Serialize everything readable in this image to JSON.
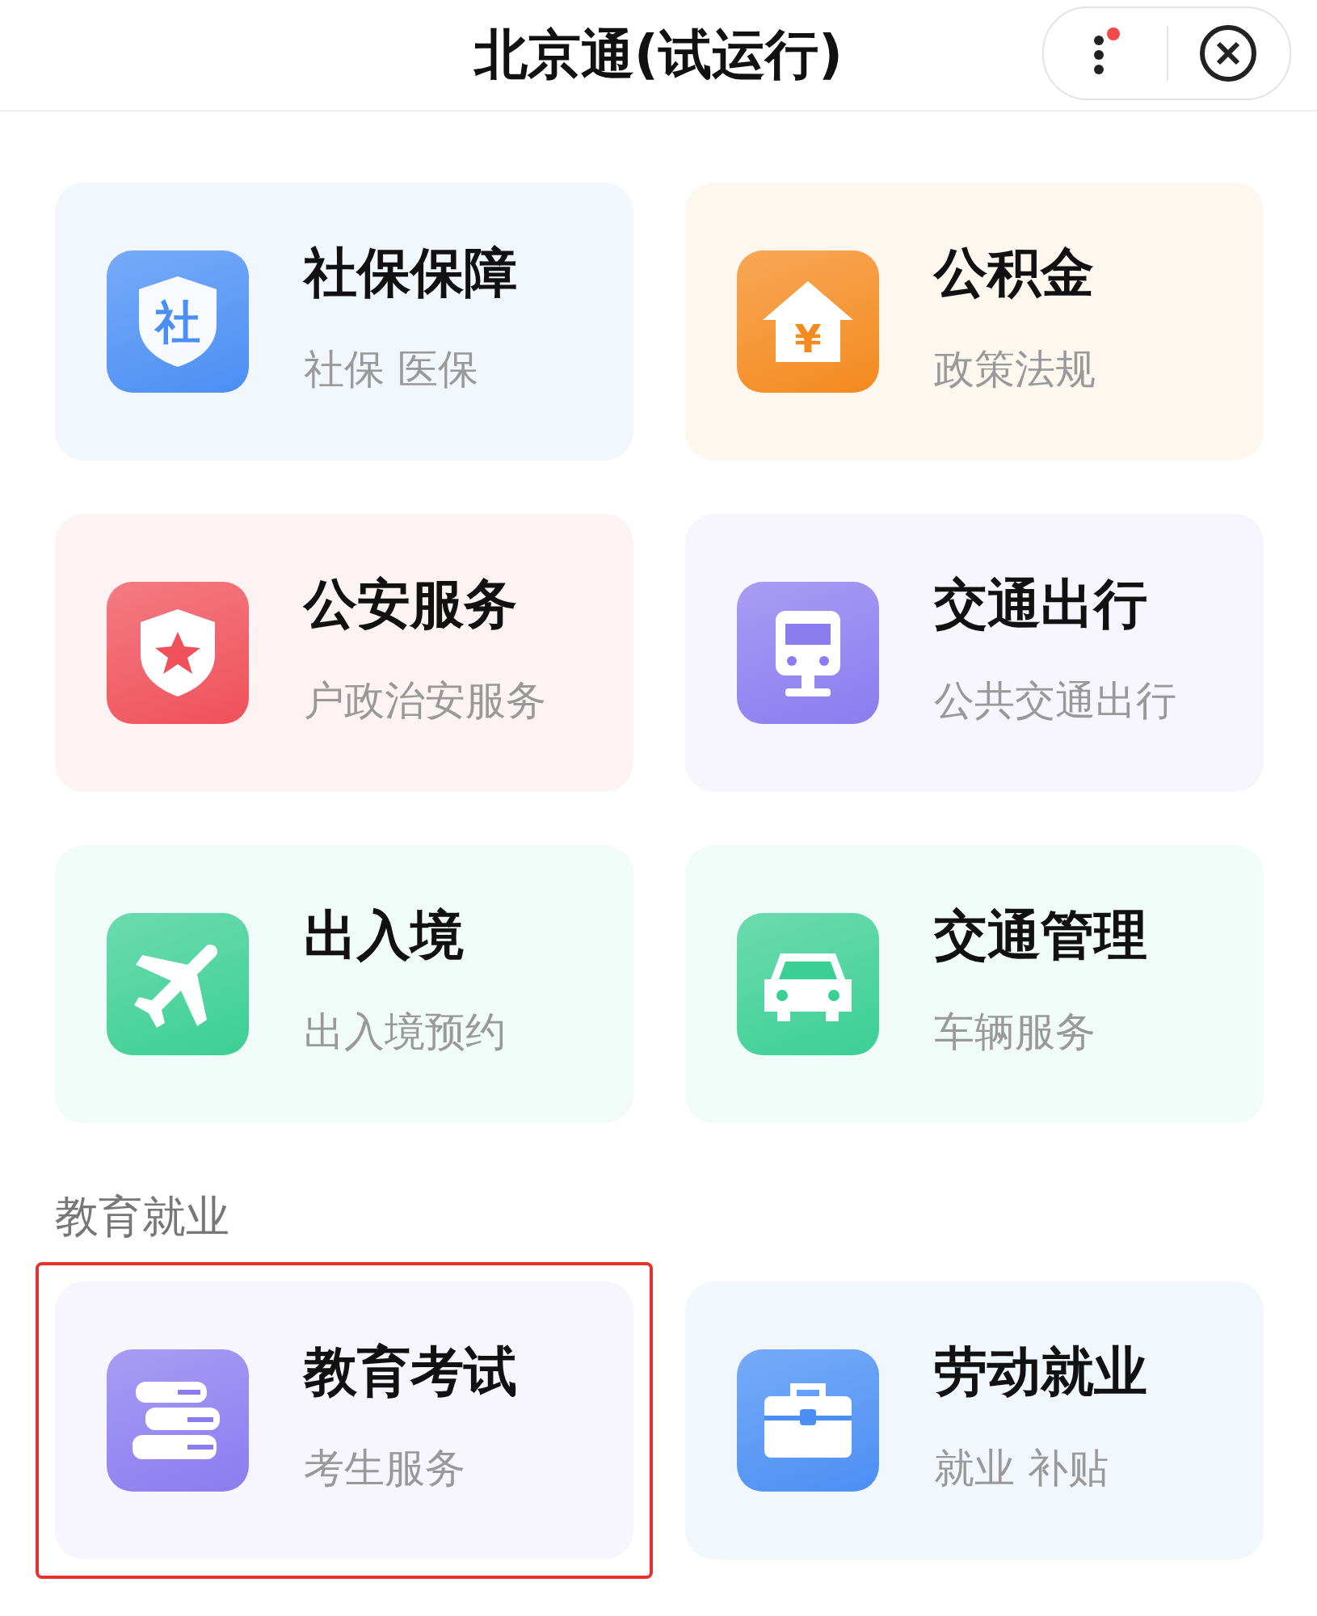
{
  "header": {
    "title": "北京通(试运行)",
    "has_notification": true
  },
  "groups": [
    {
      "cards": [
        {
          "title": "社保保障",
          "subtitle": "社保 医保",
          "kind": "shield-char",
          "icon_text": "社",
          "color": "#4b8ff5",
          "highlighted": false
        },
        {
          "title": "公积金",
          "subtitle": "政策法规",
          "kind": "house-yen",
          "icon_text": "¥",
          "color": "#f58a1f",
          "highlighted": false
        },
        {
          "title": "公安服务",
          "subtitle": "户政治安服务",
          "kind": "shield-star",
          "color": "#f0505a",
          "highlighted": false
        },
        {
          "title": "交通出行",
          "subtitle": "公共交通出行",
          "kind": "train",
          "color": "#8b7cf0",
          "highlighted": false
        },
        {
          "title": "出入境",
          "subtitle": "出入境预约",
          "kind": "plane",
          "color": "#3ccf95",
          "highlighted": false
        },
        {
          "title": "交通管理",
          "subtitle": "车辆服务",
          "kind": "car",
          "color": "#3ccf95",
          "highlighted": false
        }
      ]
    },
    {
      "heading": "教育就业",
      "cards": [
        {
          "title": "教育考试",
          "subtitle": "考生服务",
          "kind": "books",
          "color": "#8b7cf0",
          "highlighted": true
        },
        {
          "title": "劳动就业",
          "subtitle": "就业 补贴",
          "kind": "briefcase",
          "color": "#4b8ff5",
          "highlighted": false
        }
      ]
    }
  ]
}
